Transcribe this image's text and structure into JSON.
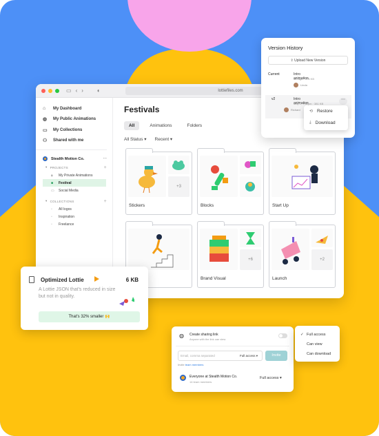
{
  "colors": {
    "background": "#4d90f7",
    "yellow": "#ffc20e",
    "pink": "#f8a5ea",
    "accent_green": "#1b9a54"
  },
  "browser": {
    "url": "lottiefiles.com"
  },
  "sidebar": {
    "nav": [
      {
        "icon": "home-icon",
        "label": "My Dashboard"
      },
      {
        "icon": "globe-icon",
        "label": "My Public Animations"
      },
      {
        "icon": "folder-icon",
        "label": "My Collections"
      },
      {
        "icon": "users-icon",
        "label": "Shared with me"
      }
    ],
    "team": {
      "name": "Stealth Motion Co.",
      "more": "⋯"
    },
    "projects_header": "PROJECTS",
    "projects": [
      {
        "label": "My Private Animations",
        "icon": "lock-icon"
      },
      {
        "label": "Festival",
        "icon": "folder-icon",
        "active": true
      },
      {
        "label": "Social Media",
        "icon": "folder-icon"
      }
    ],
    "collections_header": "COLLECTIONS",
    "collections": [
      {
        "label": "All logos"
      },
      {
        "label": "Inspiration"
      },
      {
        "label": "Freelance"
      }
    ]
  },
  "main": {
    "title": "Festivals",
    "tabs": [
      "All",
      "Animations",
      "Folders"
    ],
    "filters": [
      "All Status ▾",
      "Recent ▾"
    ],
    "folders": [
      {
        "label": "Stickers",
        "more": "+3"
      },
      {
        "label": "Blocks",
        "more": ""
      },
      {
        "label": "Start Up",
        "more": ""
      },
      {
        "label": "",
        "more": ""
      },
      {
        "label": "Brand Visual",
        "more": "+6"
      },
      {
        "label": "Launch",
        "more": "+2"
      }
    ]
  },
  "version_history": {
    "title": "Version History",
    "upload_label": "Upload New Version",
    "versions": [
      {
        "tag": "Current",
        "name": "Intro animation",
        "meta": "5m ago · 376 KB",
        "author": "Linda"
      },
      {
        "tag": "v2",
        "name": "Intro animation",
        "meta": "May 2, 7:52pm · 381 KB",
        "author": "Richard"
      }
    ],
    "menu": [
      "Restore",
      "Download"
    ]
  },
  "optimized": {
    "title": "Optimized Lottie",
    "size": "6 KB",
    "description": "A Lottie JSON that's reduced in size but not in quality.",
    "result": "That's 32% smaller 🙌"
  },
  "share": {
    "toggle_title": "Create sharing link",
    "toggle_subtitle": "Anyone with the link can view",
    "email_placeholder": "Email, comma separated",
    "email_access": "Full access ▾",
    "invite_label": "Invite",
    "invite_note_prefix": "Invite",
    "invite_note_link": "team members",
    "org_name": "Everyone at Stealth Motion Co.",
    "org_members": "14 team members",
    "org_access": "Full access ▾"
  },
  "access_menu": {
    "options": [
      "Full access",
      "Can view",
      "Can download"
    ],
    "selected": "Full access"
  }
}
